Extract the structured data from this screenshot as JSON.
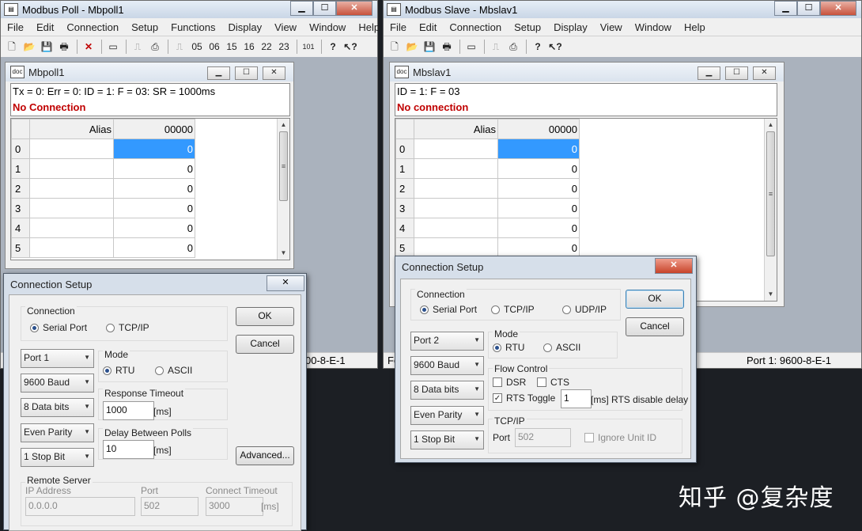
{
  "poll": {
    "window_title": "Modbus Poll - Mbpoll1",
    "menu": [
      "File",
      "Edit",
      "Connection",
      "Setup",
      "Functions",
      "Display",
      "View",
      "Window",
      "Help"
    ],
    "toolbar_codes": [
      "05",
      "06",
      "15",
      "16",
      "22",
      "23",
      "101"
    ],
    "child_title": "Mbpoll1",
    "info_line": "Tx = 0: Err = 0: ID = 1: F = 03: SR = 1000ms",
    "status_line": "No Connection",
    "grid": {
      "alias_header": "Alias",
      "address_header": "00000",
      "rows": [
        {
          "index": "0",
          "value": "0"
        },
        {
          "index": "1",
          "value": "0"
        },
        {
          "index": "2",
          "value": "0"
        },
        {
          "index": "3",
          "value": "0"
        },
        {
          "index": "4",
          "value": "0"
        },
        {
          "index": "5",
          "value": "0"
        }
      ]
    },
    "statusbar_right": "00-8-E-1"
  },
  "slave": {
    "window_title": "Modbus Slave - Mbslav1",
    "menu": [
      "File",
      "Edit",
      "Connection",
      "Setup",
      "Display",
      "View",
      "Window",
      "Help"
    ],
    "child_title": "Mbslav1",
    "info_line": "ID = 1: F = 03",
    "status_line": "No connection",
    "grid": {
      "alias_header": "Alias",
      "address_header": "00000",
      "rows": [
        {
          "index": "0",
          "value": "0"
        },
        {
          "index": "1",
          "value": "0"
        },
        {
          "index": "2",
          "value": "0"
        },
        {
          "index": "3",
          "value": "0"
        },
        {
          "index": "4",
          "value": "0"
        },
        {
          "index": "5",
          "value": "0"
        }
      ]
    },
    "statusbar_left": "Fo",
    "statusbar_right": "Port 1: 9600-8-E-1"
  },
  "poll_dialog": {
    "title": "Connection Setup",
    "connection_label": "Connection",
    "serial_port": "Serial Port",
    "tcpip": "TCP/IP",
    "port": "Port 1",
    "baud": "9600 Baud",
    "data_bits": "8 Data bits",
    "parity": "Even Parity",
    "stop_bit": "1 Stop Bit",
    "mode_label": "Mode",
    "rtu": "RTU",
    "ascii": "ASCII",
    "response_timeout_label": "Response Timeout",
    "response_timeout": "1000",
    "ms": "[ms]",
    "delay_label": "Delay Between Polls",
    "delay": "10",
    "ok": "OK",
    "cancel": "Cancel",
    "advanced": "Advanced...",
    "remote_server": "Remote Server",
    "ip_label": "IP Address",
    "ip": "0.0.0.0",
    "port_label": "Port",
    "port_value": "502",
    "connect_timeout_label": "Connect Timeout",
    "connect_timeout": "3000"
  },
  "slave_dialog": {
    "title": "Connection Setup",
    "connection_label": "Connection",
    "serial_port": "Serial Port",
    "tcpip": "TCP/IP",
    "udpip": "UDP/IP",
    "port": "Port 2",
    "baud": "9600 Baud",
    "data_bits": "8 Data bits",
    "parity": "Even Parity",
    "stop_bit": "1 Stop Bit",
    "mode_label": "Mode",
    "rtu": "RTU",
    "ascii": "ASCII",
    "flow_control_label": "Flow Control",
    "dsr": "DSR",
    "cts": "CTS",
    "rts_toggle": "RTS Toggle",
    "rts_delay": "1",
    "rts_delay_suffix": "[ms] RTS disable delay",
    "tcpip_label": "TCP/IP",
    "port_label": "Port",
    "port_value": "502",
    "ignore_unit_id": "Ignore Unit ID",
    "ok": "OK",
    "cancel": "Cancel"
  },
  "watermark": "知乎 @复杂度"
}
